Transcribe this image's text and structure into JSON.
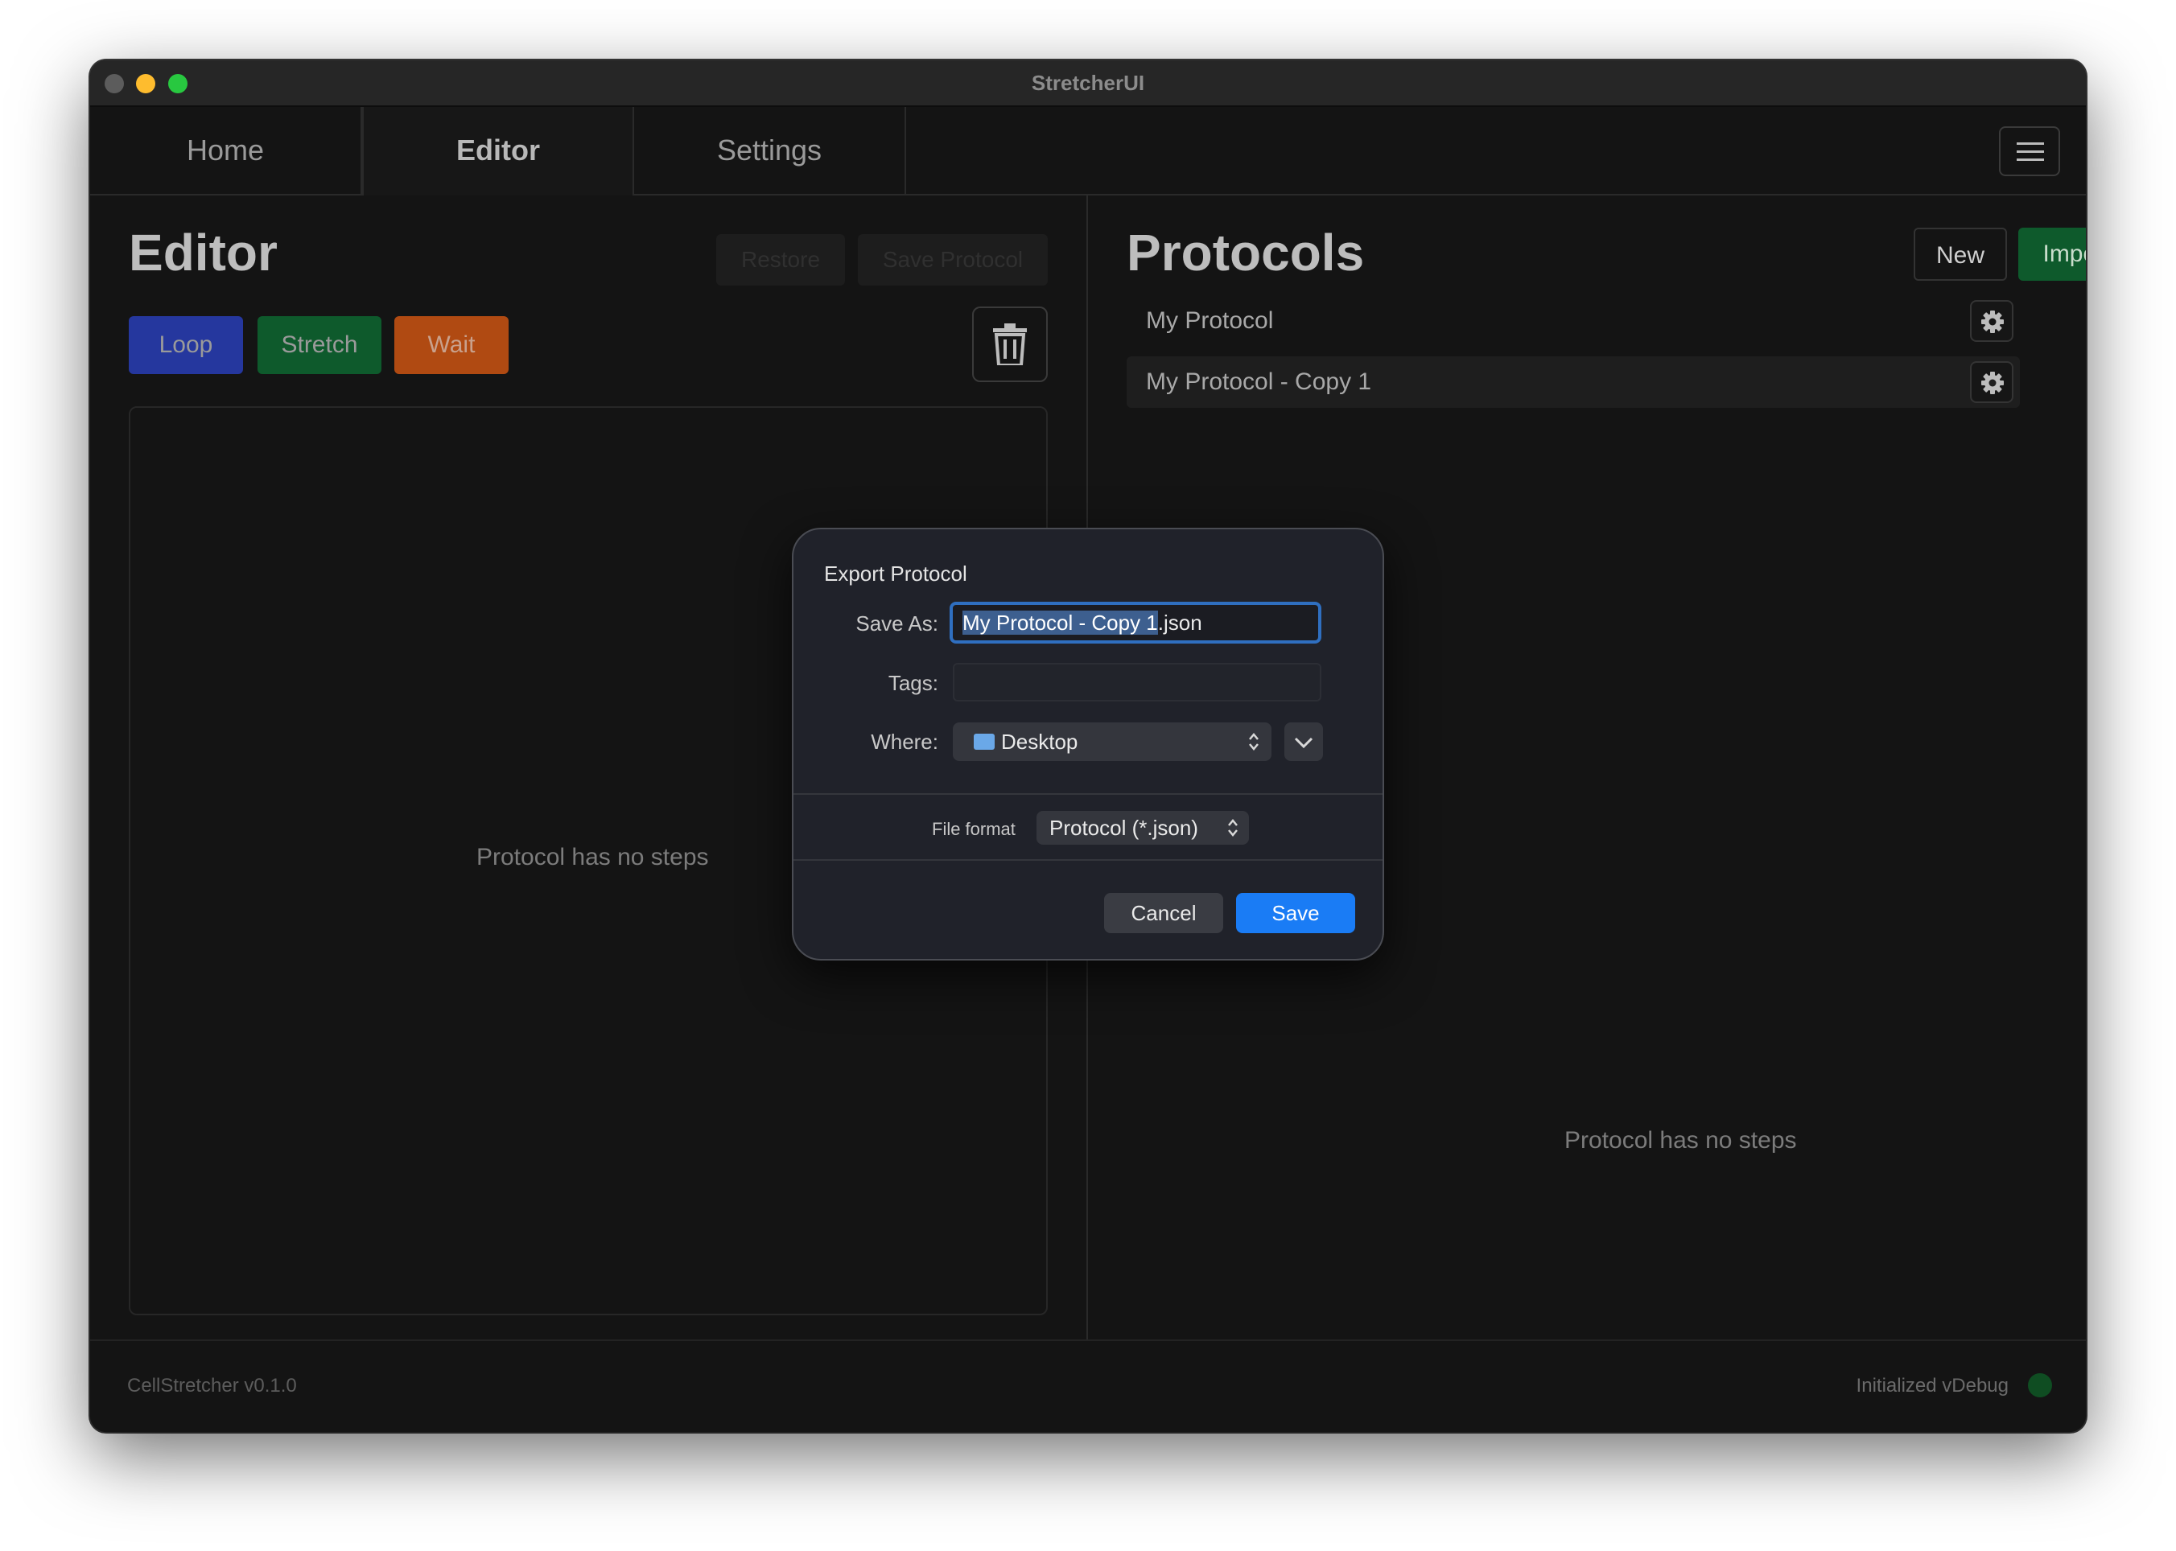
{
  "window": {
    "title": "StretcherUI"
  },
  "tabs": [
    {
      "label": "Home"
    },
    {
      "label": "Editor"
    },
    {
      "label": "Settings"
    }
  ],
  "editor": {
    "heading": "Editor",
    "restore_label": "Restore",
    "save_protocol_label": "Save Protocol",
    "step_buttons": {
      "loop": "Loop",
      "stretch": "Stretch",
      "wait": "Wait"
    },
    "empty_text": "Protocol has no steps"
  },
  "protocols": {
    "heading": "Protocols",
    "new_label": "New",
    "import_label": "Import",
    "items": [
      {
        "name": "My Protocol",
        "selected": false
      },
      {
        "name": "My Protocol - Copy 1",
        "selected": true
      }
    ],
    "empty_text": "Protocol has no steps"
  },
  "footer": {
    "version": "CellStretcher v0.1.0",
    "status": "Initialized vDebug",
    "status_color": "#0f4d22"
  },
  "dialog": {
    "title": "Export Protocol",
    "save_as_label": "Save As:",
    "save_as_selected": "My Protocol - Copy 1",
    "save_as_ext": ".json",
    "tags_label": "Tags:",
    "tags_value": "",
    "where_label": "Where:",
    "where_value": "Desktop",
    "file_format_label": "File format",
    "file_format_value": "Protocol (*.json)",
    "cancel_label": "Cancel",
    "save_label": "Save"
  },
  "colors": {
    "loop": "#25379e",
    "stretch": "#0e5a2c",
    "wait": "#b04a12",
    "accent": "#1a7cf5"
  }
}
